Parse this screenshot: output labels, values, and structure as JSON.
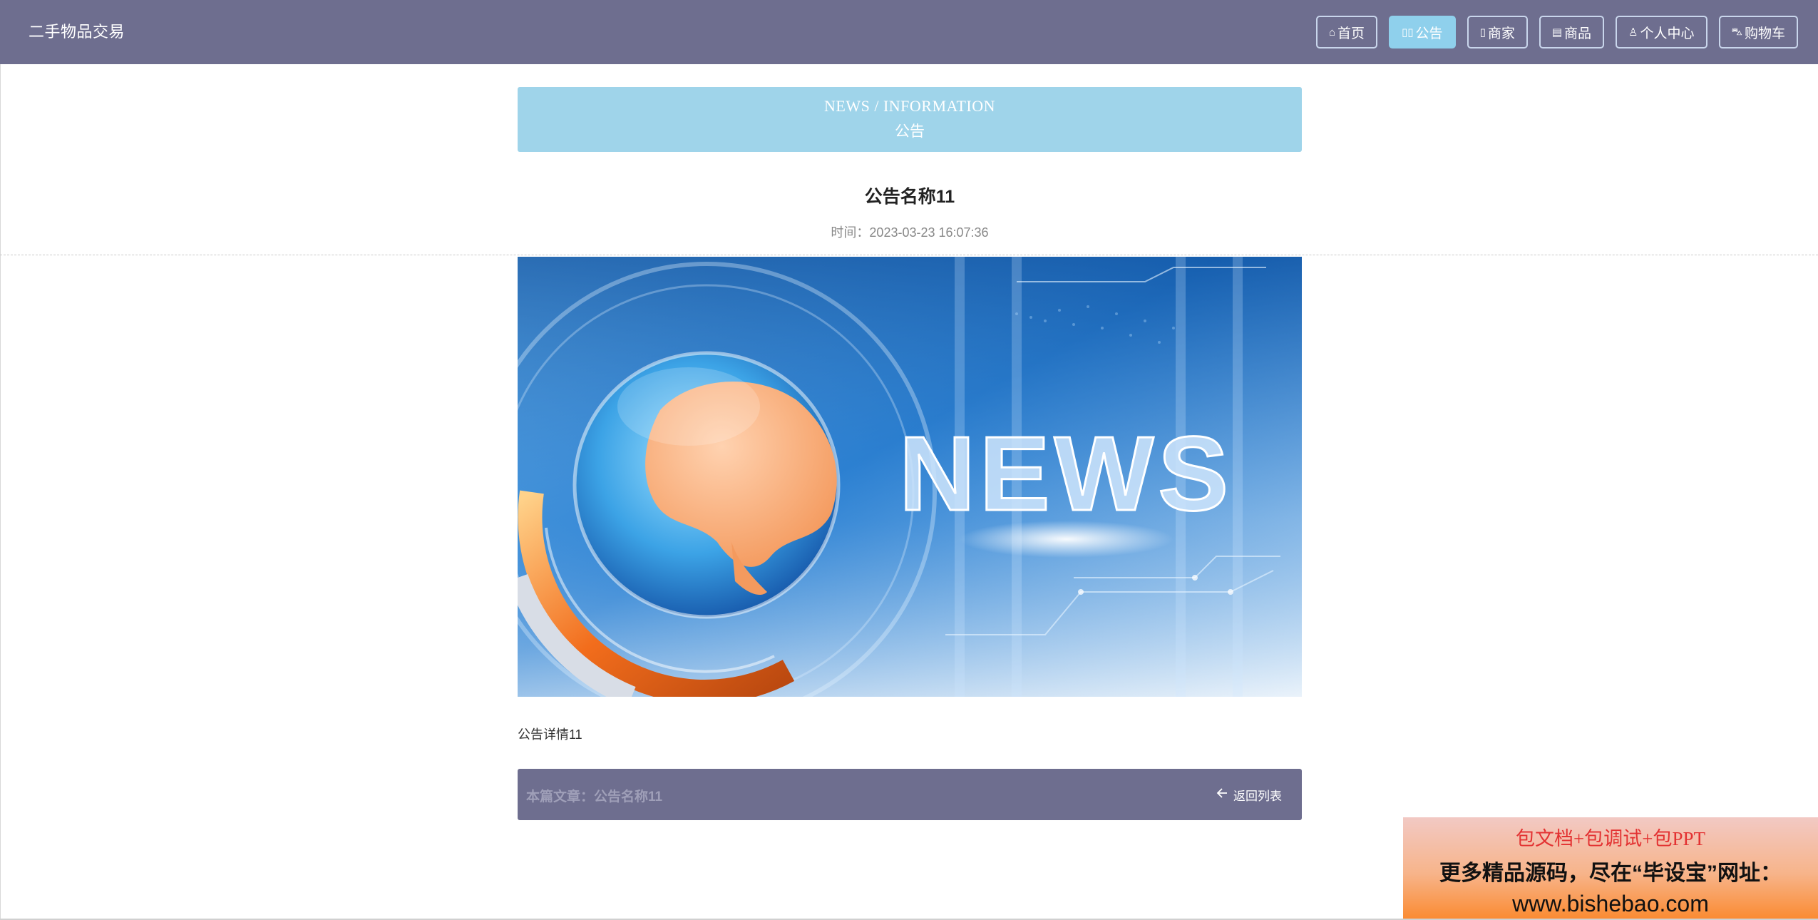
{
  "header": {
    "brand": "二手物品交易",
    "nav": [
      {
        "label": "首页",
        "icon": "home-icon",
        "active": false
      },
      {
        "label": "公告",
        "icon": "notice-icon",
        "active": true
      },
      {
        "label": "商家",
        "icon": "store-icon",
        "active": false
      },
      {
        "label": "商品",
        "icon": "goods-icon",
        "active": false
      },
      {
        "label": "个人中心",
        "icon": "user-icon",
        "active": false
      },
      {
        "label": "购物车",
        "icon": "cart-icon",
        "active": false
      }
    ]
  },
  "banner": {
    "en": "NEWS / INFORMATION",
    "cn": "公告"
  },
  "article": {
    "title": "公告名称11",
    "time": "时间：2023-03-23 16:07:36",
    "image_text": "NEWS",
    "body": "公告详情11"
  },
  "footer": {
    "current": "本篇文章：公告名称11",
    "back": "返回列表"
  },
  "promo": {
    "line1": "包文档+包调试+包PPT",
    "line2": "更多精品源码，尽在“毕设宝”网址：",
    "line3": "www.bishebao.com"
  },
  "colors": {
    "header_bg": "#6e6e8f",
    "active_nav": "#8fd0ec",
    "banner_bg": "#9fd4ea"
  }
}
